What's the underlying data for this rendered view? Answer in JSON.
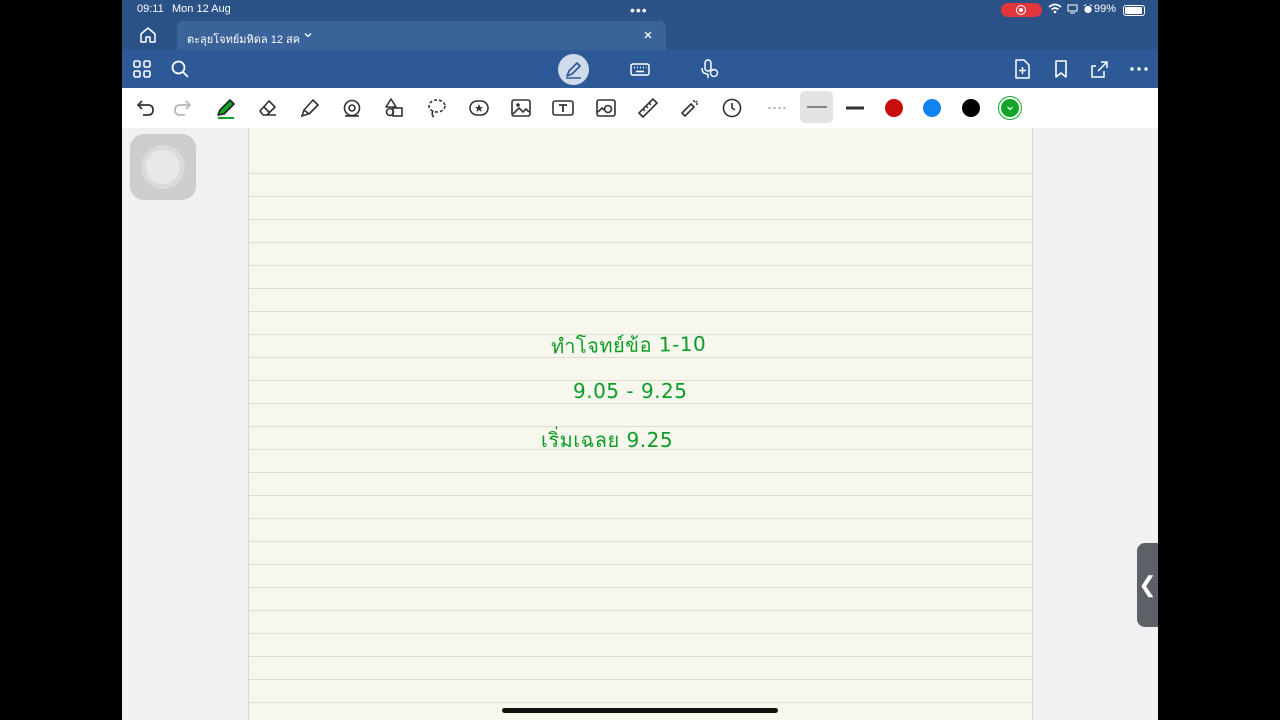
{
  "status_bar": {
    "time": "09:11",
    "date": "Mon 12 Aug",
    "battery": "99%"
  },
  "tab": {
    "title": "ตะลุยโจทย์มหิดล 12 สค"
  },
  "toolbar": {
    "active_tool": "pen",
    "selected_stroke": "medium",
    "selected_color": "#12a52a",
    "colors": [
      "#c90c0c",
      "#1283ec",
      "#000000",
      "#12a52a"
    ]
  },
  "note": {
    "line1": "ทำโจทย์ข้อ 1-10",
    "line2": "9.05 - 9.25",
    "line3": "เริ่มเฉลย 9.25"
  },
  "side_handle": {
    "glyph": "❮"
  },
  "colors": {
    "title_bar": "#2b5287",
    "toolbar": "#2d5a96",
    "ink": "#0d9d26",
    "paper": "#f8f7ed"
  }
}
